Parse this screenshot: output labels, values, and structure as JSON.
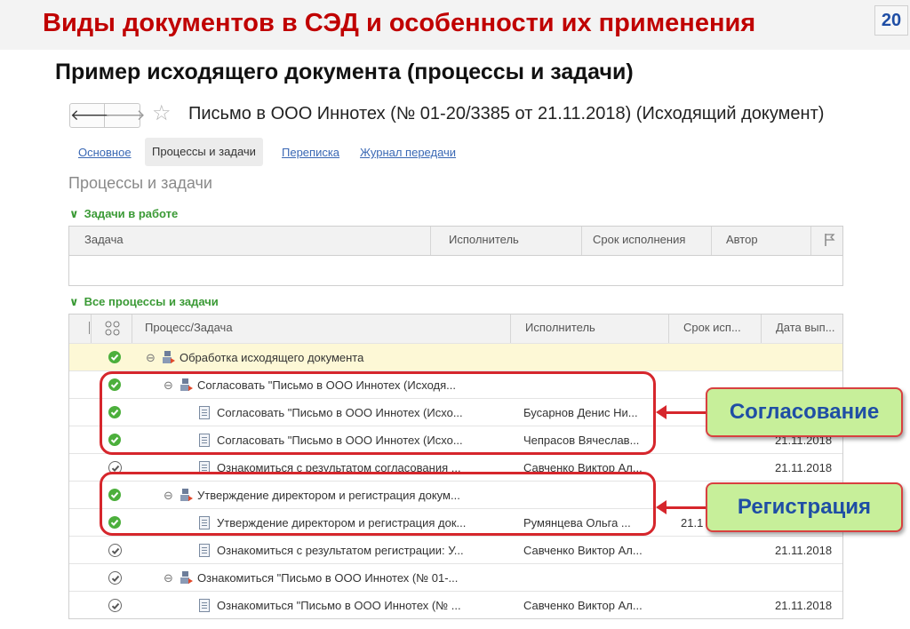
{
  "slide": {
    "title": "Виды документов в СЭД и особенности их применения",
    "page_number": "20",
    "subtitle": "Пример исходящего документа (процессы и задачи)"
  },
  "window": {
    "back_glyph": "🡐",
    "forward_glyph": "🡒",
    "doc_title": "Письмо в ООО Иннотех (№ 01-20/3385 от 21.11.2018) (Исходящий документ)"
  },
  "tabs": [
    {
      "label": "Основное"
    },
    {
      "label": "Процессы и задачи"
    },
    {
      "label": "Переписка"
    },
    {
      "label": "Журнал передачи"
    }
  ],
  "section_title": "Процессы и задачи",
  "tasks_in_work": {
    "heading": "Задачи в работе",
    "columns": [
      "Задача",
      "Исполнитель",
      "Срок исполнения",
      "Автор"
    ]
  },
  "all_processes": {
    "heading": "Все процессы и задачи",
    "columns": [
      "Процесс/Задача",
      "Исполнитель",
      "Срок исп...",
      "Дата вып..."
    ],
    "rows": [
      {
        "status": "green",
        "toggle": "⊖",
        "icon": "process",
        "text": "Обработка исходящего документа",
        "executor": "",
        "due": "",
        "done": ""
      },
      {
        "status": "green",
        "toggle": "⊖",
        "icon": "process",
        "text": "Согласовать \"Письмо в ООО Иннотех (Исходя...",
        "executor": "",
        "due": "",
        "done": ""
      },
      {
        "status": "green",
        "toggle": "",
        "icon": "doc",
        "text": "Согласовать \"Письмо в ООО Иннотех (Исхо...",
        "executor": "Бусарнов Денис Ни...",
        "due": "",
        "done": ""
      },
      {
        "status": "green",
        "toggle": "",
        "icon": "doc",
        "text": "Согласовать \"Письмо в ООО Иннотех (Исхо...",
        "executor": "Чепрасов Вячеслав...",
        "due": "",
        "done": "21.11.2018"
      },
      {
        "status": "gray",
        "toggle": "",
        "icon": "doc",
        "text": "Ознакомиться с результатом согласования ...",
        "executor": "Савченко Виктор Ал...",
        "due": "",
        "done": "21.11.2018"
      },
      {
        "status": "green",
        "toggle": "⊖",
        "icon": "process",
        "text": "Утверждение директором и регистрация докум...",
        "executor": "",
        "due": "",
        "done": ""
      },
      {
        "status": "green",
        "toggle": "",
        "icon": "doc",
        "text": "Утверждение директором и регистрация док...",
        "executor": "Румянцева Ольга ...",
        "due": "21.1",
        "done": ""
      },
      {
        "status": "gray",
        "toggle": "",
        "icon": "doc",
        "text": "Ознакомиться с результатом регистрации: У...",
        "executor": "Савченко Виктор Ал...",
        "due": "",
        "done": "21.11.2018"
      },
      {
        "status": "gray",
        "toggle": "⊖",
        "icon": "process",
        "text": "Ознакомиться \"Письмо в ООО Иннотех (№ 01-...",
        "executor": "",
        "due": "",
        "done": ""
      },
      {
        "status": "gray",
        "toggle": "",
        "icon": "doc",
        "text": "Ознакомиться \"Письмо в ООО Иннотех (№ ...",
        "executor": "Савченко Виктор Ал...",
        "due": "",
        "done": "21.11.2018"
      }
    ]
  },
  "callouts": {
    "approval": "Согласование",
    "registration": "Регистрация"
  },
  "colors": {
    "title_red": "#c00000",
    "status_green": "#4caf3c",
    "callout_bg": "#c7ef9a",
    "callout_text": "#1f4ea5",
    "highlight_red": "#d6262c"
  }
}
